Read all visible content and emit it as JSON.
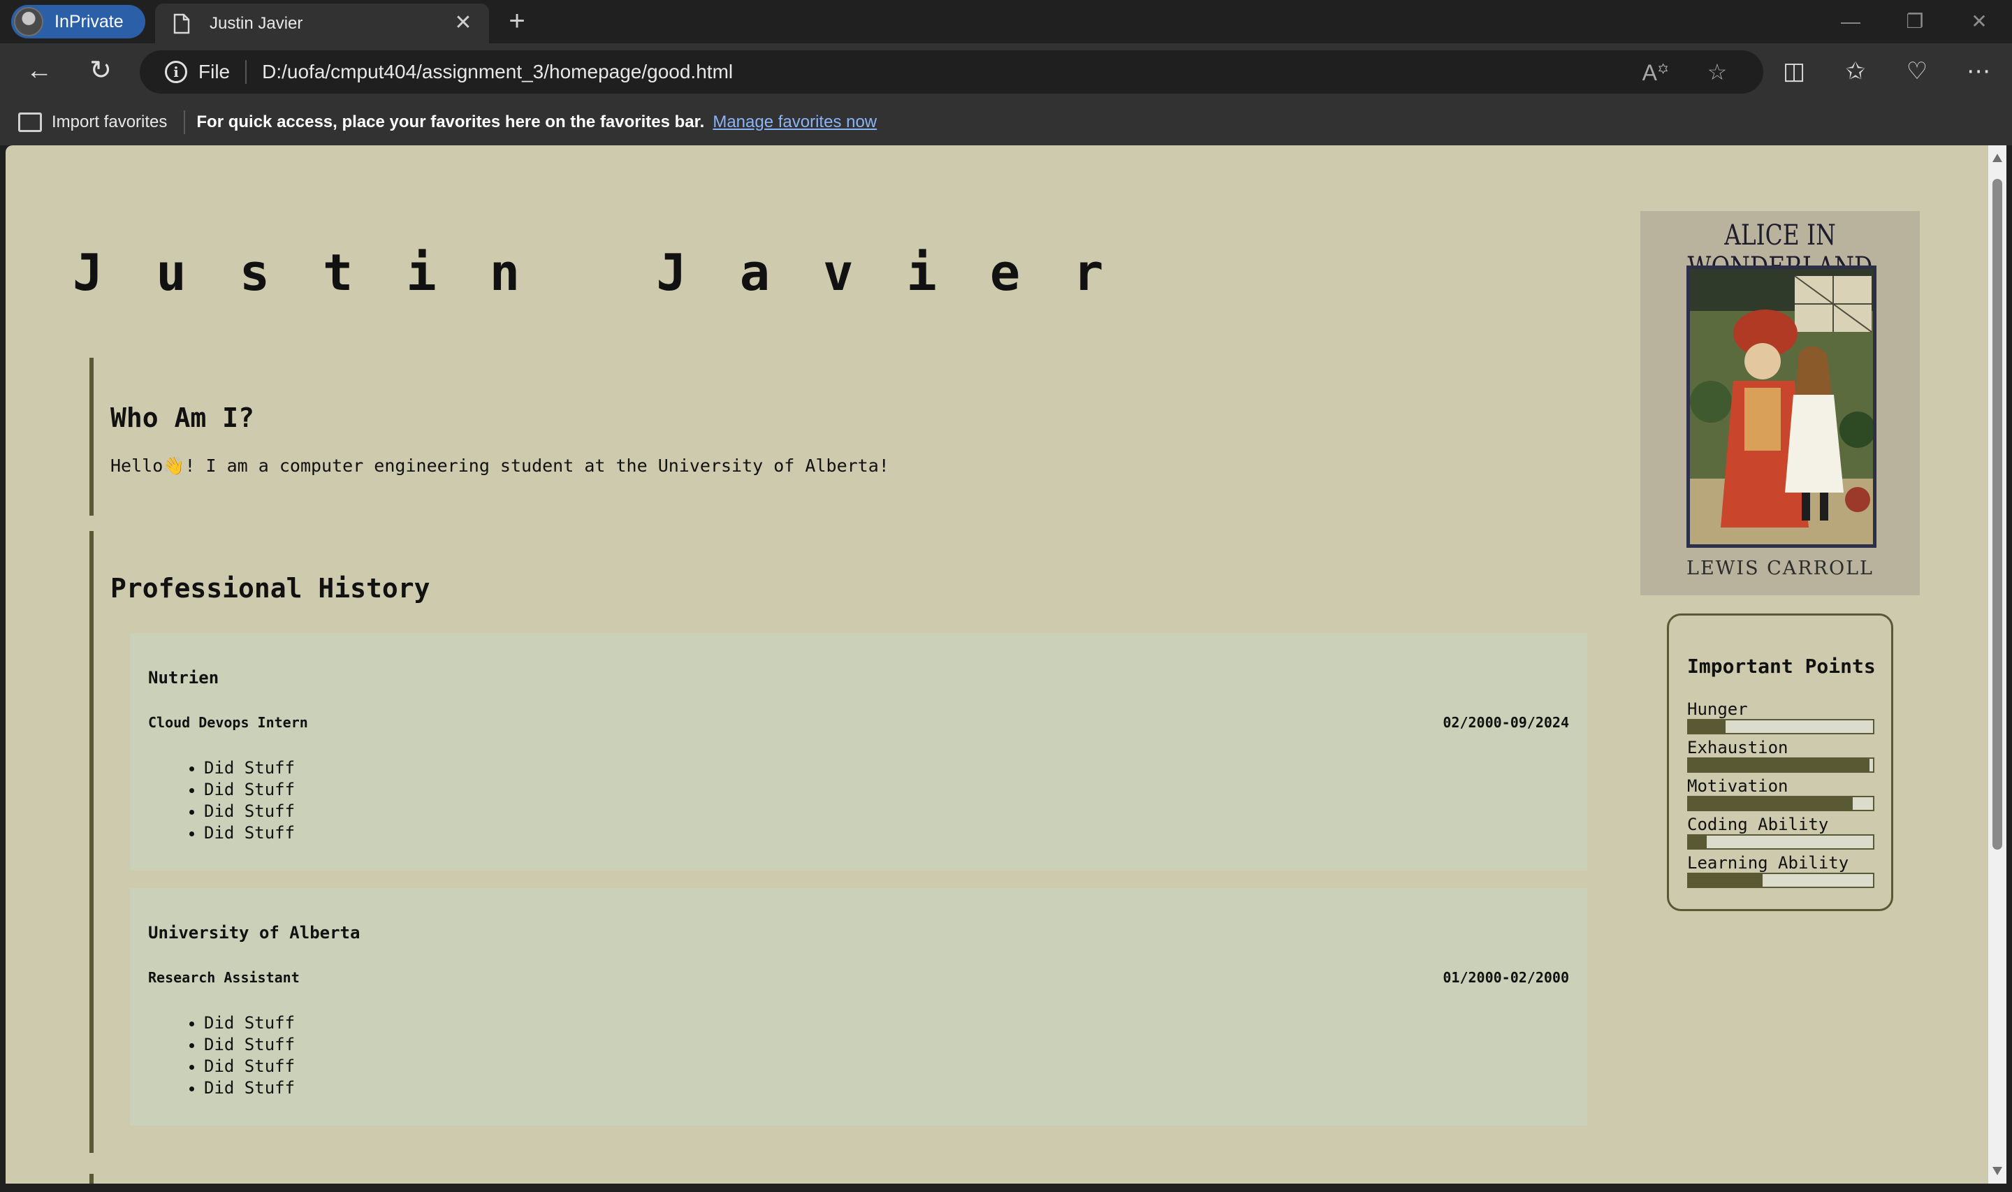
{
  "browser": {
    "inprivate_label": "InPrivate",
    "tab_title": "Justin Javier",
    "url_scheme": "File",
    "url": "D:/uofa/cmput404/assignment_3/homepage/good.html",
    "favorites": {
      "import_label": "Import favorites",
      "message": "For quick access, place your favorites here on the favorites bar.",
      "link": "Manage favorites now"
    }
  },
  "page": {
    "title": "Justin Javier",
    "who": {
      "heading": "Who Am I?",
      "text": "Hello👋! I am a computer engineering student at the University of Alberta!"
    },
    "history": {
      "heading": "Professional History",
      "jobs": [
        {
          "company": "Nutrien",
          "role": "Cloud Devops Intern",
          "dates": "02/2000-09/2024",
          "items": [
            "Did Stuff",
            "Did Stuff",
            "Did Stuff",
            "Did Stuff"
          ]
        },
        {
          "company": "University of Alberta",
          "role": "Research Assistant",
          "dates": "01/2000-02/2000",
          "items": [
            "Did Stuff",
            "Did Stuff",
            "Did Stuff",
            "Did Stuff"
          ]
        }
      ]
    },
    "book": {
      "title": "ALICE IN WONDERLAND",
      "author": "LEWIS CARROLL"
    },
    "important_points": {
      "heading": "Important Points",
      "stats": [
        {
          "name": "Hunger",
          "level": 0.2
        },
        {
          "name": "Exhaustion",
          "level": 0.98
        },
        {
          "name": "Motivation",
          "level": 0.89
        },
        {
          "name": "Coding Ability",
          "level": 0.1
        },
        {
          "name": "Learning Ability",
          "level": 0.4
        }
      ]
    }
  }
}
